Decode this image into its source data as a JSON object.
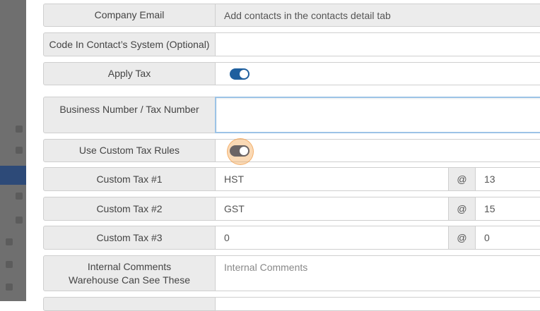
{
  "form": {
    "company_email": {
      "label": "Company Email",
      "value": "Add contacts in the contacts detail tab"
    },
    "contact_code": {
      "label": "Code In Contact’s System (Optional)",
      "value": ""
    },
    "apply_tax": {
      "label": "Apply Tax",
      "on": true
    },
    "business_number": {
      "label": "Business Number / Tax Number",
      "value": ""
    },
    "custom_tax_rules": {
      "label": "Use Custom Tax Rules",
      "on": true
    },
    "custom_taxes": [
      {
        "label": "Custom Tax #1",
        "name": "HST",
        "at": "@",
        "rate": "13"
      },
      {
        "label": "Custom Tax #2",
        "name": "GST",
        "at": "@",
        "rate": "15"
      },
      {
        "label": "Custom Tax #3",
        "name": "0",
        "at": "@",
        "rate": "0"
      }
    ],
    "internal_comments": {
      "label_line1": "Internal Comments",
      "label_line2": "Warehouse Can See These",
      "placeholder": "Internal Comments"
    }
  },
  "colors": {
    "toggle_on": "#1f5f9e",
    "toggle_pressed": "#6b6464",
    "focus_ring": "#9cc3e6"
  }
}
